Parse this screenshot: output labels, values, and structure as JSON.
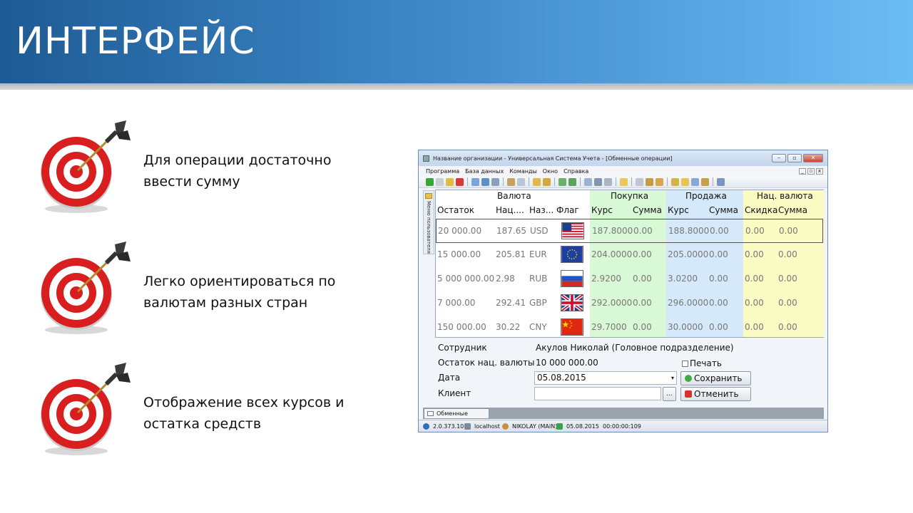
{
  "slide": {
    "title": "ИНТЕРФЕЙС",
    "bullets": [
      {
        "line1": "Для операции достаточно",
        "line2": "ввести сумму"
      },
      {
        "line1": "Легко ориентироваться по",
        "line2": "валютам разных стран"
      },
      {
        "line1": "Отображение всех курсов и",
        "line2": "остатка средств"
      }
    ]
  },
  "window": {
    "title": "Название организации - Универсальная Система Учета - [Обменные операции]",
    "menu": [
      "Программа",
      "База данных",
      "Команды",
      "Окно",
      "Справка"
    ],
    "side_panel_label": "Меню пользователя",
    "grid": {
      "group_headers": {
        "currency": "Валюта",
        "buy": "Покупка",
        "sell": "Продажа",
        "national": "Нац. валюта"
      },
      "columns": {
        "balance": "Остаток",
        "nat": "Нац....",
        "name": "Наз...",
        "flag": "Флаг",
        "buy_rate": "Курс",
        "buy_sum": "Сумма",
        "sell_rate": "Курс",
        "sell_sum": "Сумма",
        "discount": "Скидка",
        "nat_sum": "Сумма"
      },
      "rows": [
        {
          "balance": "20 000.00",
          "nat": "187.65",
          "code": "USD",
          "flag": "us-flag",
          "buy_rate": "187.8000",
          "buy_sum": "0.00",
          "sell_rate": "188.8000",
          "sell_sum": "0.00",
          "discount": "0.00",
          "nat_sum": "0.00"
        },
        {
          "balance": "15 000.00",
          "nat": "205.81",
          "code": "EUR",
          "flag": "eu-flag",
          "buy_rate": "204.0000",
          "buy_sum": "0.00",
          "sell_rate": "205.0000",
          "sell_sum": "0.00",
          "discount": "0.00",
          "nat_sum": "0.00"
        },
        {
          "balance": "5 000 000.00",
          "nat": "2.98",
          "code": "RUB",
          "flag": "ru-flag",
          "buy_rate": "2.9200",
          "buy_sum": "0.00",
          "sell_rate": "3.0200",
          "sell_sum": "0.00",
          "discount": "0.00",
          "nat_sum": "0.00"
        },
        {
          "balance": "7 000.00",
          "nat": "292.41",
          "code": "GBP",
          "flag": "gb-flag",
          "buy_rate": "292.0000",
          "buy_sum": "0.00",
          "sell_rate": "296.0000",
          "sell_sum": "0.00",
          "discount": "0.00",
          "nat_sum": "0.00"
        },
        {
          "balance": "150 000.00",
          "nat": "30.22",
          "code": "CNY",
          "flag": "cn-flag",
          "buy_rate": "29.7000",
          "buy_sum": "0.00",
          "sell_rate": "30.0000",
          "sell_sum": "0.00",
          "discount": "0.00",
          "nat_sum": "0.00"
        }
      ]
    },
    "form": {
      "employee_label": "Сотрудник",
      "employee_value": "Акулов Николай (Головное подразделение)",
      "nat_balance_label": "Остаток нац. валюты",
      "nat_balance_value": "10 000 000.00",
      "print_label": "Печать",
      "date_label": "Дата",
      "date_value": "05.08.2015",
      "client_label": "Клиент",
      "client_value": "",
      "browse_label": "...",
      "save_label": "Сохранить",
      "cancel_label": "Отменить"
    },
    "tab_label": "Обменные операции",
    "status": {
      "version": "2.0.373.10",
      "host": "localhost",
      "user": "NIKOLAY (MAIN)",
      "date": "05.08.2015",
      "time": "00:00:00:109"
    },
    "colors": {
      "buy_bg": "#d9f8d6",
      "sell_bg": "#d6e9fa",
      "national_bg": "#fbfbc4"
    }
  }
}
